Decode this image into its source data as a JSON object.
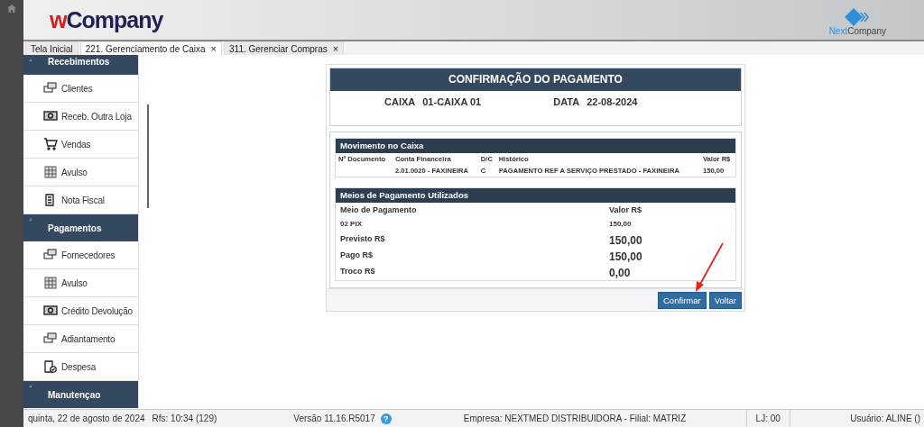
{
  "header": {
    "logo": {
      "accent": "w",
      "rest": "Company"
    },
    "brand": {
      "accent": "Next",
      "rest": "Company"
    }
  },
  "tabs": [
    {
      "label": "Tela Inicial",
      "selected": false
    },
    {
      "label": "221. Gerenciamento de Caixa",
      "selected": true,
      "close": "×"
    },
    {
      "label": "311. Gerenciar Compras",
      "selected": false,
      "close": "×"
    }
  ],
  "sidebar": {
    "sections": [
      {
        "title": "Recebimentos",
        "items": [
          {
            "label": "Clientes",
            "kind": "cards"
          },
          {
            "label": "Receb. Outra Loja",
            "kind": "cash"
          },
          {
            "label": "Vendas",
            "kind": "cart"
          },
          {
            "label": "Avulso",
            "kind": "grid"
          },
          {
            "label": "Nota Fiscal",
            "kind": "doc"
          }
        ]
      },
      {
        "title": "Pagamentos",
        "items": [
          {
            "label": "Fornecedores",
            "kind": "cards"
          },
          {
            "label": "Avulso",
            "kind": "grid"
          },
          {
            "label": "Crédito Devolução",
            "kind": "cash"
          },
          {
            "label": "Adiantamento",
            "kind": "cards"
          },
          {
            "label": "Despesa",
            "kind": "check"
          }
        ]
      },
      {
        "title": "Manutençao"
      }
    ]
  },
  "confirmation": {
    "title": "CONFIRMAÇÃO DO PAGAMENTO",
    "caixa_label": "CAIXA",
    "caixa_value": "01-CAIXA 01",
    "data_label": "DATA",
    "data_value": "22-08-2024"
  },
  "movimento": {
    "title": "Movimento no Caixa",
    "columns": [
      "Nº Documento",
      "Conta Financeira",
      "D/C",
      "Histórico",
      "Valor R$"
    ],
    "rows": [
      [
        "",
        "2.01.0020 - FAXINEIRA",
        "C",
        "PAGAMENTO REF A SERVIÇO PRESTADO - FAXINEIRA",
        "150,00"
      ]
    ]
  },
  "meios": {
    "title": "Meios de Pagamento Utilizados",
    "columns": [
      "Meio de Pagamento",
      "Valor R$"
    ],
    "rows": [
      [
        "02 PIX",
        "150,00"
      ]
    ],
    "totals": [
      {
        "label": "Previsto R$",
        "value": "150,00"
      },
      {
        "label": "Pago R$",
        "value": "150,00"
      },
      {
        "label": "Troco R$",
        "value": "0,00"
      }
    ]
  },
  "buttons": [
    "Confirmar",
    "Voltar"
  ],
  "status_bar": {
    "date": "quinta, 22 de agosto de 2024",
    "rfs": "Rfs: 10:34 (129)",
    "version": "Versão 11.16.R5017",
    "help": "?",
    "empresa": "Empresa: NEXTMED DISTRIBUIDORA - Filial: MATRIZ",
    "loja": "LJ: 00",
    "usuario": "Usuário: ALINE ()"
  }
}
